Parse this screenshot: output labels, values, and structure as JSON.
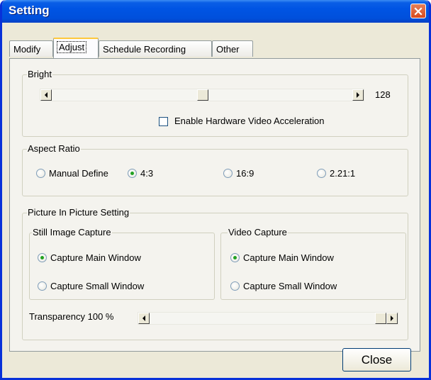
{
  "window": {
    "title": "Setting"
  },
  "tabs": [
    {
      "label": "Modify",
      "active": false
    },
    {
      "label": "Adjust",
      "active": true
    },
    {
      "label": "Schedule Recording",
      "active": false
    },
    {
      "label": "Other",
      "active": false
    }
  ],
  "bright": {
    "legend": "Bright",
    "value": "128",
    "hw_accel_label": "Enable Hardware Video Acceleration",
    "hw_accel_checked": false
  },
  "aspect_ratio": {
    "legend": "Aspect Ratio",
    "options": [
      "Manual Define",
      "4:3",
      "16:9",
      "2.21:1"
    ],
    "selected": "4:3"
  },
  "pip": {
    "legend": "Picture In Picture Setting",
    "still_image": {
      "legend": "Still Image Capture",
      "options": [
        "Capture Main Window",
        "Capture Small Window"
      ],
      "selected": "Capture Main Window"
    },
    "video": {
      "legend": "Video Capture",
      "options": [
        "Capture Main Window",
        "Capture Small Window"
      ],
      "selected": "Capture Main Window"
    },
    "transparency_label": "Transparency 100 %",
    "transparency_level": 1.0
  },
  "buttons": {
    "close": "Close"
  }
}
